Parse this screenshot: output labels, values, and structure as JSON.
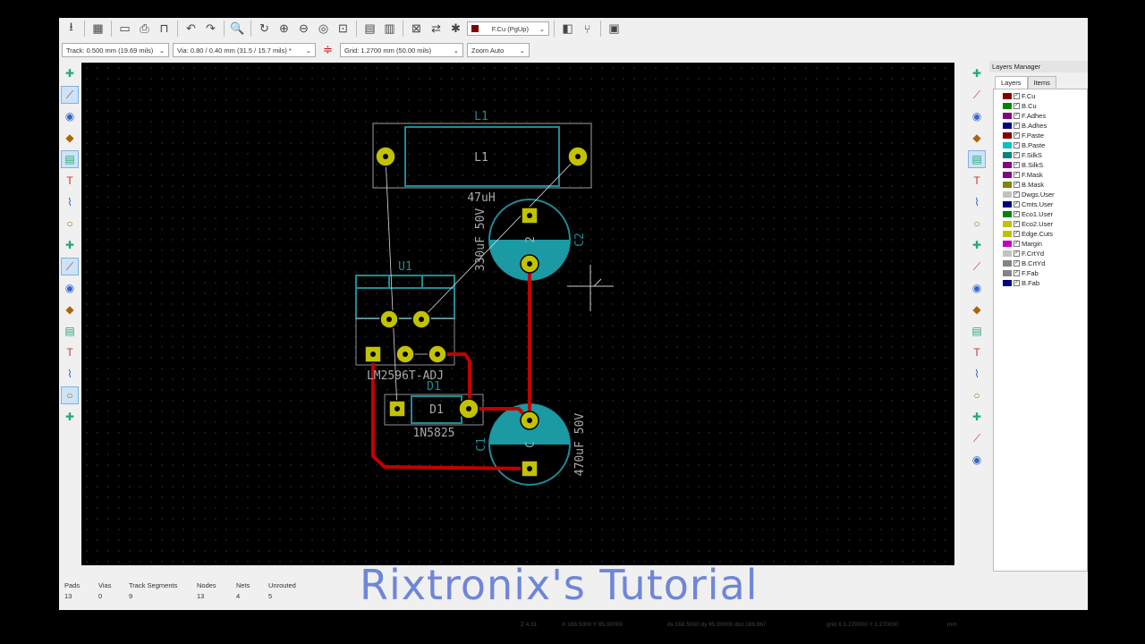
{
  "toolbar": {
    "layer_select": "F.Cu (PgUp)",
    "track": "Track: 0.500 mm (19.69 mils)",
    "via": "Via: 0.80 / 0.40 mm (31.5 / 15.7 mils) *",
    "grid": "Grid: 1.2700 mm (50.00 mils)",
    "zoom": "Zoom Auto",
    "icons": [
      "save-icon",
      "board-setup-icon",
      "page-settings-icon",
      "print-icon",
      "plot-icon",
      "undo-icon",
      "redo-icon",
      "find-icon",
      "redraw-icon",
      "zoom-in-icon",
      "zoom-out-icon",
      "zoom-fit-icon",
      "zoom-selection-icon",
      "footprint-editor-icon",
      "footprint-browser-icon",
      "netlist-icon",
      "update-pcb-icon",
      "drc-icon",
      "layer-pair-icon",
      "autoroute-icon",
      "scripting-console-icon"
    ]
  },
  "left_toolbar": [
    "drc-marker-icon",
    "grid-icon",
    "polar-coords-icon",
    "inch-units-icon",
    "mm-units-icon",
    "cursor-shape-icon",
    "ratsnest-icon",
    "module-ratsnest-icon",
    "zone-fill-icon",
    "zone-outline-icon",
    "zone-sketch-icon",
    "pad-sketch-icon",
    "via-sketch-icon",
    "track-sketch-icon",
    "high-contrast-icon",
    "microwave-icon",
    "layers-manager-icon"
  ],
  "right_toolbar": [
    "select-icon",
    "highlight-net-icon",
    "local-ratsnest-icon",
    "add-footprint-icon",
    "route-track-icon",
    "add-via-icon",
    "add-zone-icon",
    "keepout-icon",
    "add-line-icon",
    "add-circle-icon",
    "add-arc-icon",
    "add-polygon-icon",
    "add-text-icon",
    "add-dimension-icon",
    "add-target-icon",
    "delete-icon",
    "set-origin-icon",
    "grid-origin-icon",
    "measure-icon"
  ],
  "layers_manager": {
    "title": "Layers Manager",
    "tabs": [
      "Layers",
      "Items"
    ],
    "layers": [
      {
        "name": "F.Cu",
        "color": "#840000"
      },
      {
        "name": "B.Cu",
        "color": "#008400"
      },
      {
        "name": "F.Adhes",
        "color": "#840084"
      },
      {
        "name": "B.Adhes",
        "color": "#000084"
      },
      {
        "name": "F.Paste",
        "color": "#840000"
      },
      {
        "name": "B.Paste",
        "color": "#00c2c2"
      },
      {
        "name": "F.SilkS",
        "color": "#008484"
      },
      {
        "name": "B.SilkS",
        "color": "#840084"
      },
      {
        "name": "F.Mask",
        "color": "#840084"
      },
      {
        "name": "B.Mask",
        "color": "#848400"
      },
      {
        "name": "Dwgs.User",
        "color": "#c2c2c2"
      },
      {
        "name": "Cmts.User",
        "color": "#000084"
      },
      {
        "name": "Eco1.User",
        "color": "#008400"
      },
      {
        "name": "Eco2.User",
        "color": "#c2c200"
      },
      {
        "name": "Edge.Cuts",
        "color": "#c2c200"
      },
      {
        "name": "Margin",
        "color": "#c200c2"
      },
      {
        "name": "F.CrtYd",
        "color": "#c2c2c2"
      },
      {
        "name": "B.CrtYd",
        "color": "#848484"
      },
      {
        "name": "F.Fab",
        "color": "#848484"
      },
      {
        "name": "B.Fab",
        "color": "#000084"
      }
    ]
  },
  "pcb": {
    "l1_ref": "L1",
    "l1_value": "L1",
    "l1_val": "47uH",
    "c2_ref": "C2",
    "c2_value": "330uF 50V",
    "c2_pad": "2",
    "u1_ref": "U1",
    "u1_value": "LM2596T-ADJ",
    "d1_ref": "D1",
    "d1_value": "D1",
    "d1_val": "1N5825",
    "c1_ref": "C1",
    "c1_value": "470uF 50V",
    "c1_pad": "C",
    "colors": {
      "copper_pad": "#c2c200",
      "track": "#c20000",
      "silk": "#00848a",
      "fab": "#a0a0a0"
    }
  },
  "status": {
    "headers": [
      "Pads",
      "Vias",
      "Track Segments",
      "Nodes",
      "Nets",
      "Unrouted"
    ],
    "values": [
      "13",
      "0",
      "9",
      "13",
      "4",
      "5"
    ],
    "zoom": "Z 4.31",
    "xy": "X 168.5000 Y 85.90000",
    "dxy": "dx 168.5000 dy 85.90000 dist 188.867",
    "grid": "grid X 1.270000 Y 1.270000",
    "units": "mm"
  },
  "watermark": "Rixtronix's Tutorial"
}
